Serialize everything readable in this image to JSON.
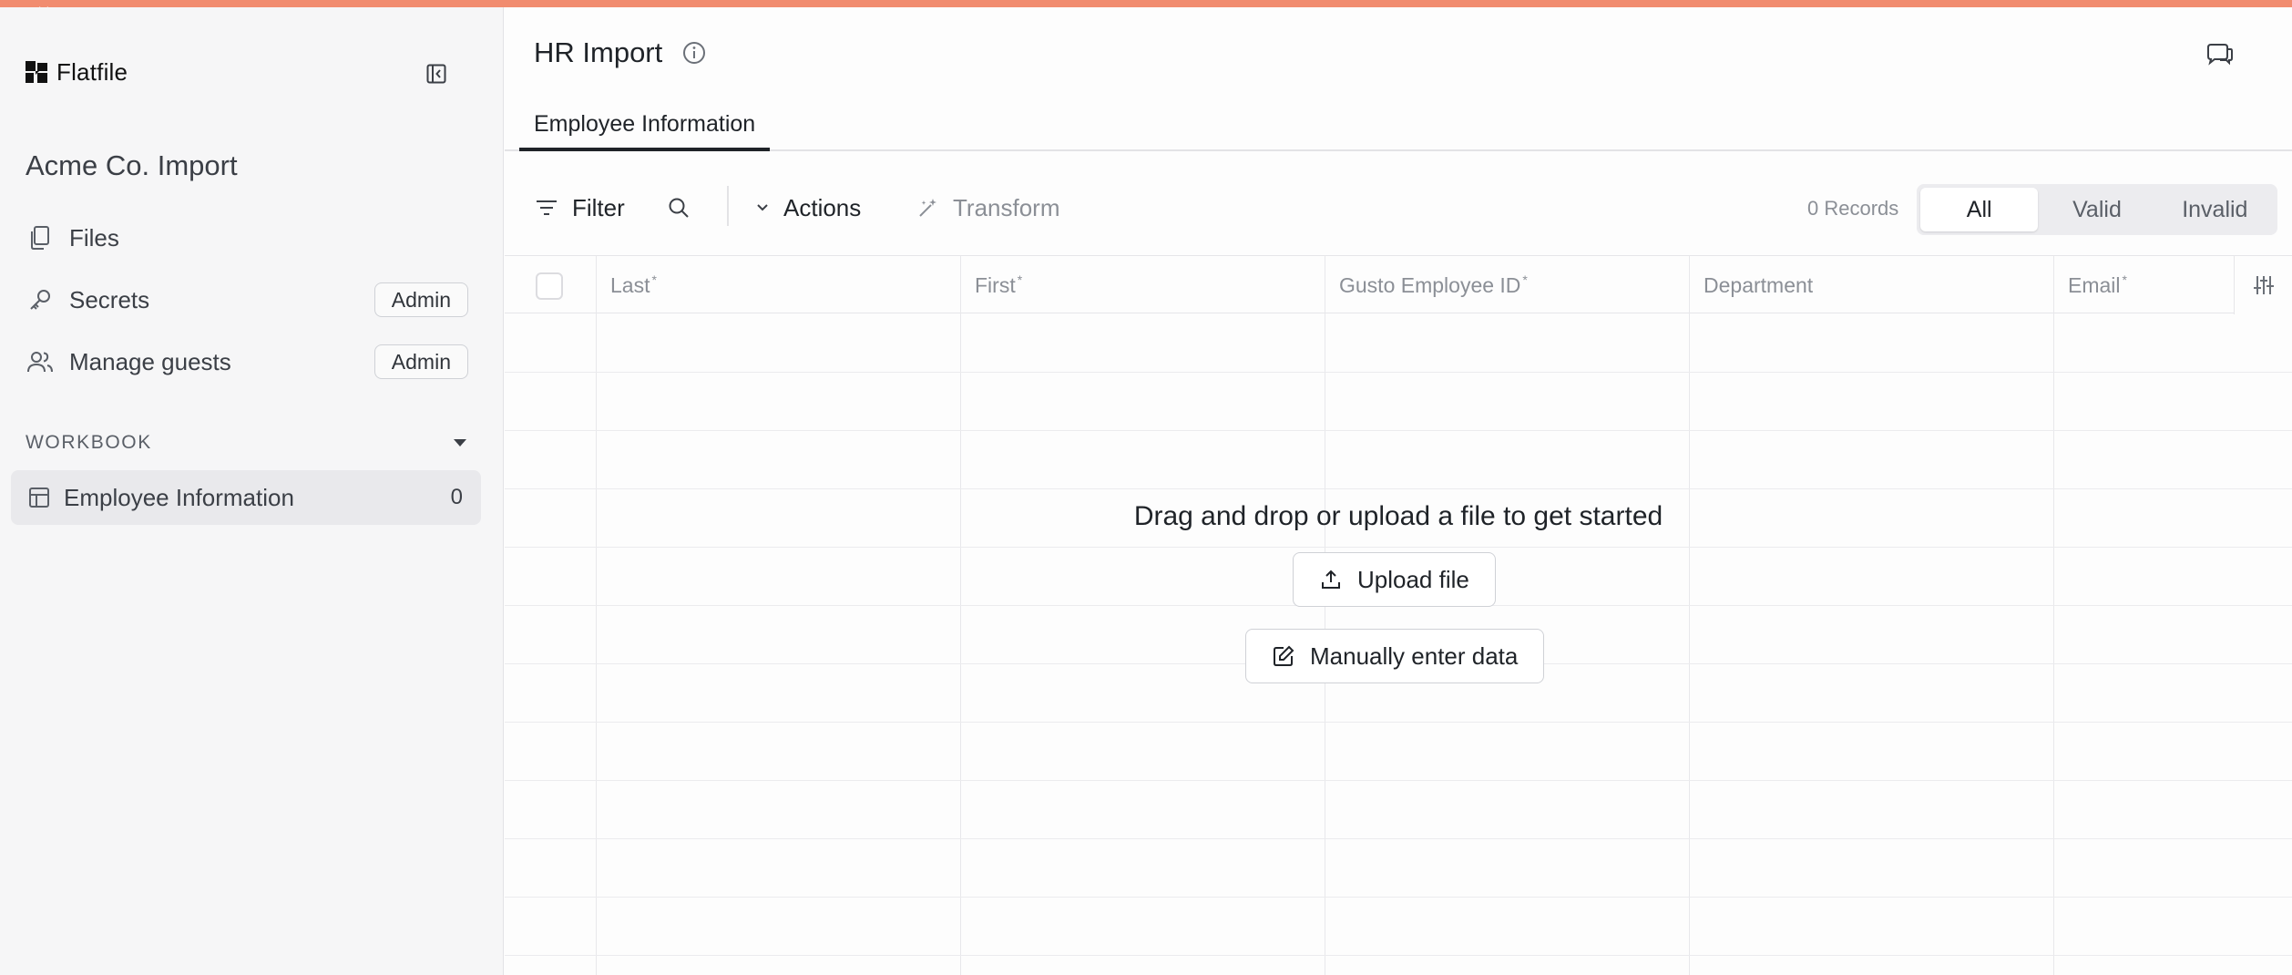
{
  "sidebar": {
    "logo_text": "Flatfile",
    "space_title": "Acme Co. Import",
    "nav": [
      {
        "label": "Files",
        "icon": "files-icon"
      },
      {
        "label": "Secrets",
        "icon": "key-icon",
        "badge": "Admin"
      },
      {
        "label": "Manage guests",
        "icon": "users-icon",
        "badge": "Admin"
      }
    ],
    "section_label": "WORKBOOK",
    "sheets": [
      {
        "label": "Employee Information",
        "count": "0",
        "icon": "table-icon"
      }
    ]
  },
  "main": {
    "title": "HR Import",
    "tabs": [
      {
        "label": "Employee Information",
        "active": true
      }
    ],
    "toolbar": {
      "filter_label": "Filter",
      "actions_label": "Actions",
      "transform_label": "Transform",
      "records_label": "0 Records",
      "segments": [
        {
          "label": "All",
          "active": true
        },
        {
          "label": "Valid",
          "active": false
        },
        {
          "label": "Invalid",
          "active": false
        }
      ]
    },
    "columns": [
      {
        "label": "Last",
        "required": true
      },
      {
        "label": "First",
        "required": true
      },
      {
        "label": "Gusto Employee ID",
        "required": true
      },
      {
        "label": "Department",
        "required": false
      },
      {
        "label": "Email",
        "required": true
      }
    ],
    "empty_state": {
      "message": "Drag and drop or upload a file to get started",
      "upload_label": "Upload file",
      "manual_label": "Manually enter data"
    }
  },
  "colors": {
    "accent": "#f18c6f",
    "sidebar_bg": "#f6f6f7",
    "text": "#1f2328",
    "muted": "#8b8f96"
  }
}
